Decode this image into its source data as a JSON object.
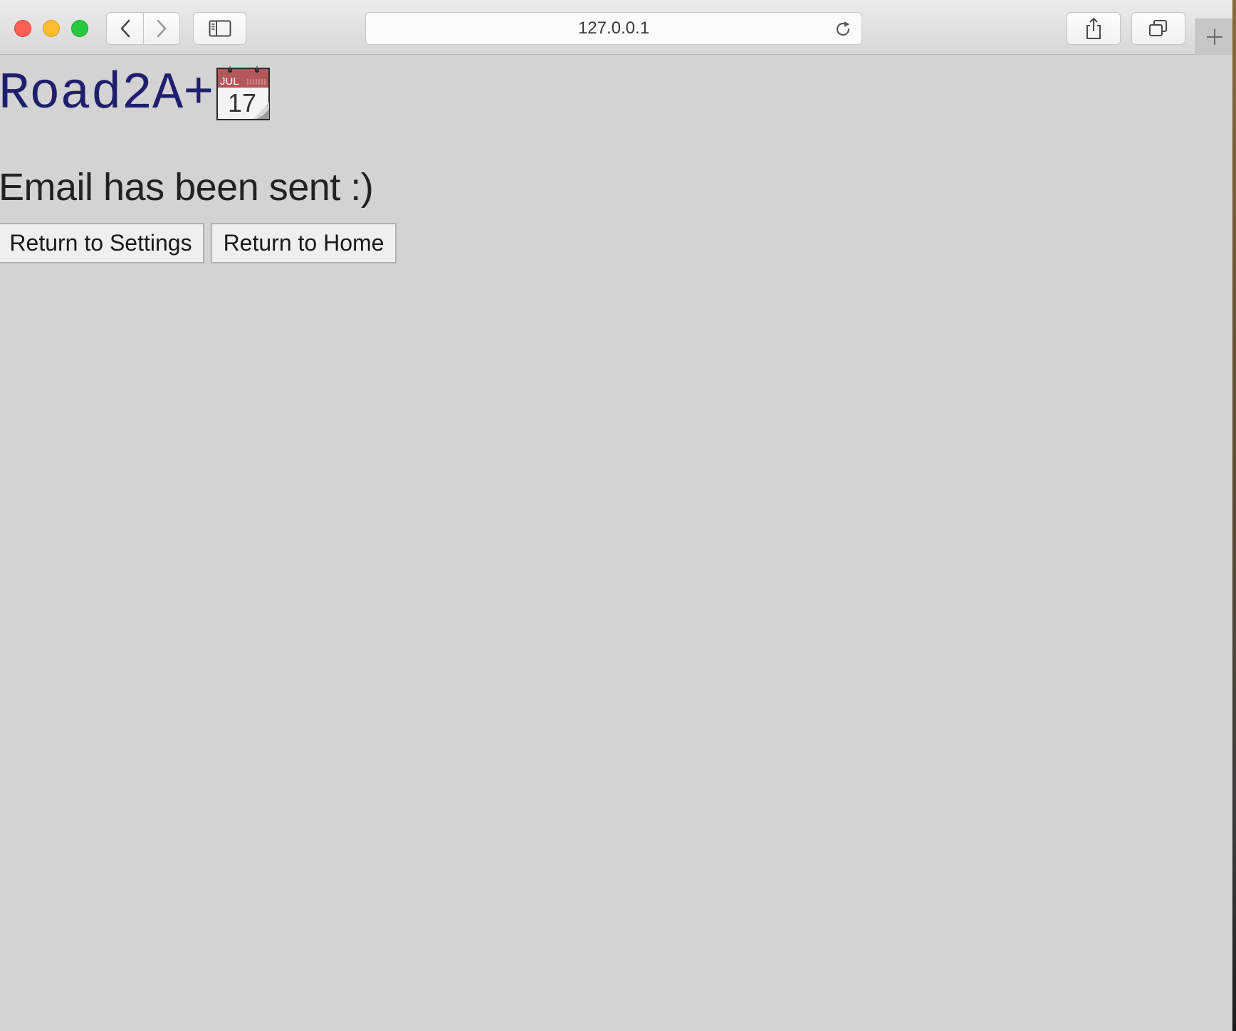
{
  "browser": {
    "address_url": "127.0.0.1",
    "icons": {
      "back": "chevron-left-icon",
      "forward": "chevron-right-icon",
      "sidebar": "sidebar-icon",
      "reload": "reload-icon",
      "share": "share-icon",
      "tabs": "tab-overview-icon",
      "new_tab": "plus-icon"
    },
    "traffic_colors": {
      "close": "#fe5f57",
      "minimize": "#febc2e",
      "maximize": "#28c840"
    }
  },
  "page": {
    "logo_text": "Road2A+",
    "logo_icon": "calendar-icon",
    "calendar_month": "JUL",
    "calendar_day": "17",
    "message": "Email has been sent :)",
    "buttons": {
      "settings": "Return to Settings",
      "home": "Return to Home"
    },
    "colors": {
      "logo": "#1f1f6e",
      "background": "#d3d3d3"
    }
  }
}
